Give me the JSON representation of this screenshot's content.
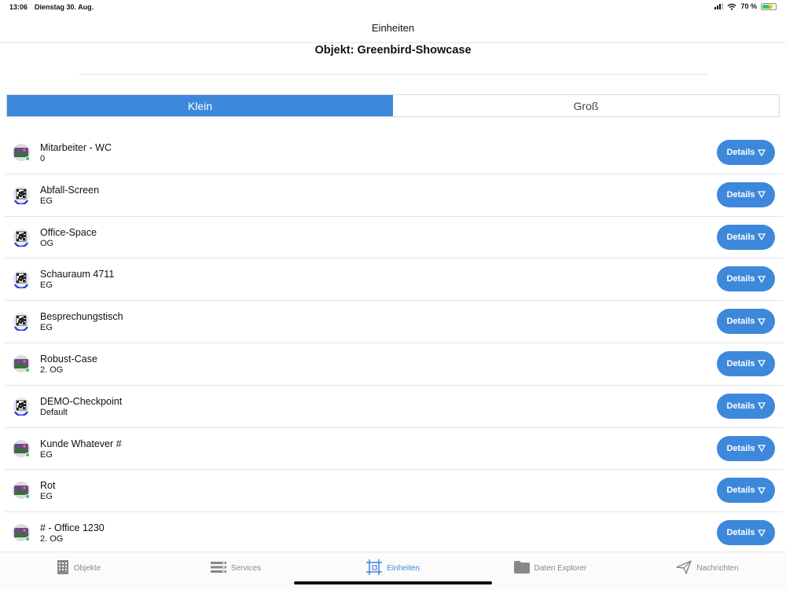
{
  "status": {
    "time": "13:06",
    "date": "Dienstag 30. Aug.",
    "battery": "70 %"
  },
  "nav": {
    "title": "Einheiten"
  },
  "header": {
    "title": "Objekt: Greenbird-Showcase"
  },
  "segments": {
    "left": "Klein",
    "right": "Groß",
    "selected": "Klein"
  },
  "details_label": "Details",
  "units": [
    {
      "name": "Mitarbeiter - WC",
      "sub": "0",
      "icon": "photo-icon"
    },
    {
      "name": "Abfall-Screen",
      "sub": "EG",
      "icon": "qr-code-icon"
    },
    {
      "name": "Office-Space",
      "sub": "OG",
      "icon": "qr-code-icon"
    },
    {
      "name": "Schauraum 4711",
      "sub": "EG",
      "icon": "qr-code-icon"
    },
    {
      "name": "Besprechungstisch",
      "sub": "EG",
      "icon": "qr-code-icon"
    },
    {
      "name": "Robust-Case",
      "sub": "2. OG",
      "icon": "photo-icon"
    },
    {
      "name": "DEMO-Checkpoint",
      "sub": "Default",
      "icon": "qr-code-icon"
    },
    {
      "name": "Kunde Whatever #",
      "sub": "EG",
      "icon": "photo-icon"
    },
    {
      "name": "Rot",
      "sub": "EG",
      "icon": "photo-icon"
    },
    {
      "name": "# - Office 1230",
      "sub": "2. OG",
      "icon": "photo-icon"
    }
  ],
  "tabs": [
    {
      "label": "Objekte",
      "icon": "building-icon"
    },
    {
      "label": "Services",
      "icon": "services-icon"
    },
    {
      "label": "Einheiten",
      "icon": "units-icon"
    },
    {
      "label": "Daten Explorer",
      "icon": "folder-icon"
    },
    {
      "label": "Nachrichten",
      "icon": "send-icon"
    }
  ],
  "active_tab": "Einheiten",
  "colors": {
    "accent": "#3e88dc",
    "tab_inactive": "#888888",
    "online_dot": "#35c759"
  }
}
